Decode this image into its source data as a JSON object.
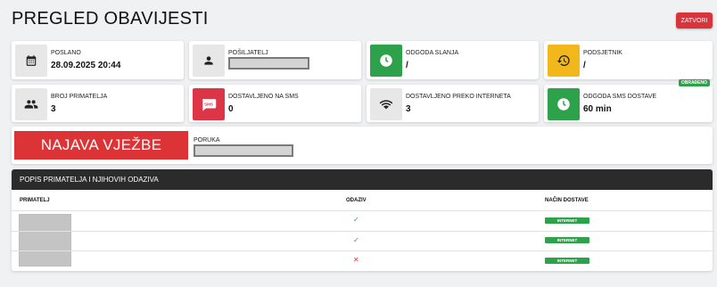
{
  "header": {
    "title": "PREGLED OBAVIJESTI",
    "close_label": "ZATVORI"
  },
  "cards": {
    "poslano": {
      "label": "POSLANO",
      "value": "28.09.2025 20:44",
      "icon": "calendar-icon"
    },
    "posiljatelj": {
      "label": "POŠILJATELJ",
      "icon": "person-icon"
    },
    "odgoda_slanja": {
      "label": "ODGODA SLANJA",
      "value": "/",
      "icon": "clock-icon"
    },
    "podsjetnik": {
      "label": "PODSJETNIK",
      "value": "/",
      "icon": "history-icon"
    },
    "broj_primatelja": {
      "label": "BROJ PRIMATELJA",
      "value": "3",
      "icon": "group-icon"
    },
    "dostavljeno_sms": {
      "label": "DOSTAVLJENO NA SMS",
      "value": "0",
      "icon": "sms-icon"
    },
    "dostavljeno_internet": {
      "label": "DOSTAVLJENO PREKO INTERNETA",
      "value": "3",
      "icon": "wifi-icon"
    },
    "odgoda_sms": {
      "label": "ODGODA SMS DOSTAVE",
      "value": "60 min",
      "badge": "OBRAĐENO",
      "icon": "clock-icon"
    }
  },
  "message": {
    "announcement": "NAJAVA VJEŽBE",
    "label": "PORUKA"
  },
  "list": {
    "title": "POPIS PRIMATELJA I NJIHOVIH ODAZIVA",
    "columns": {
      "recipient": "PRIMATELJ",
      "response": "ODAZIV",
      "method": "NAČIN DOSTAVE"
    },
    "rows": [
      {
        "response": "✓",
        "method": "INTERNET"
      },
      {
        "response": "✓",
        "method": "INTERNET"
      },
      {
        "response": "✕",
        "method": "INTERNET"
      }
    ]
  },
  "colors": {
    "accent_red": "#dc3545",
    "accent_green": "#2ea24a",
    "accent_yellow": "#f2b81b",
    "header_dark": "#2b2b2b"
  }
}
